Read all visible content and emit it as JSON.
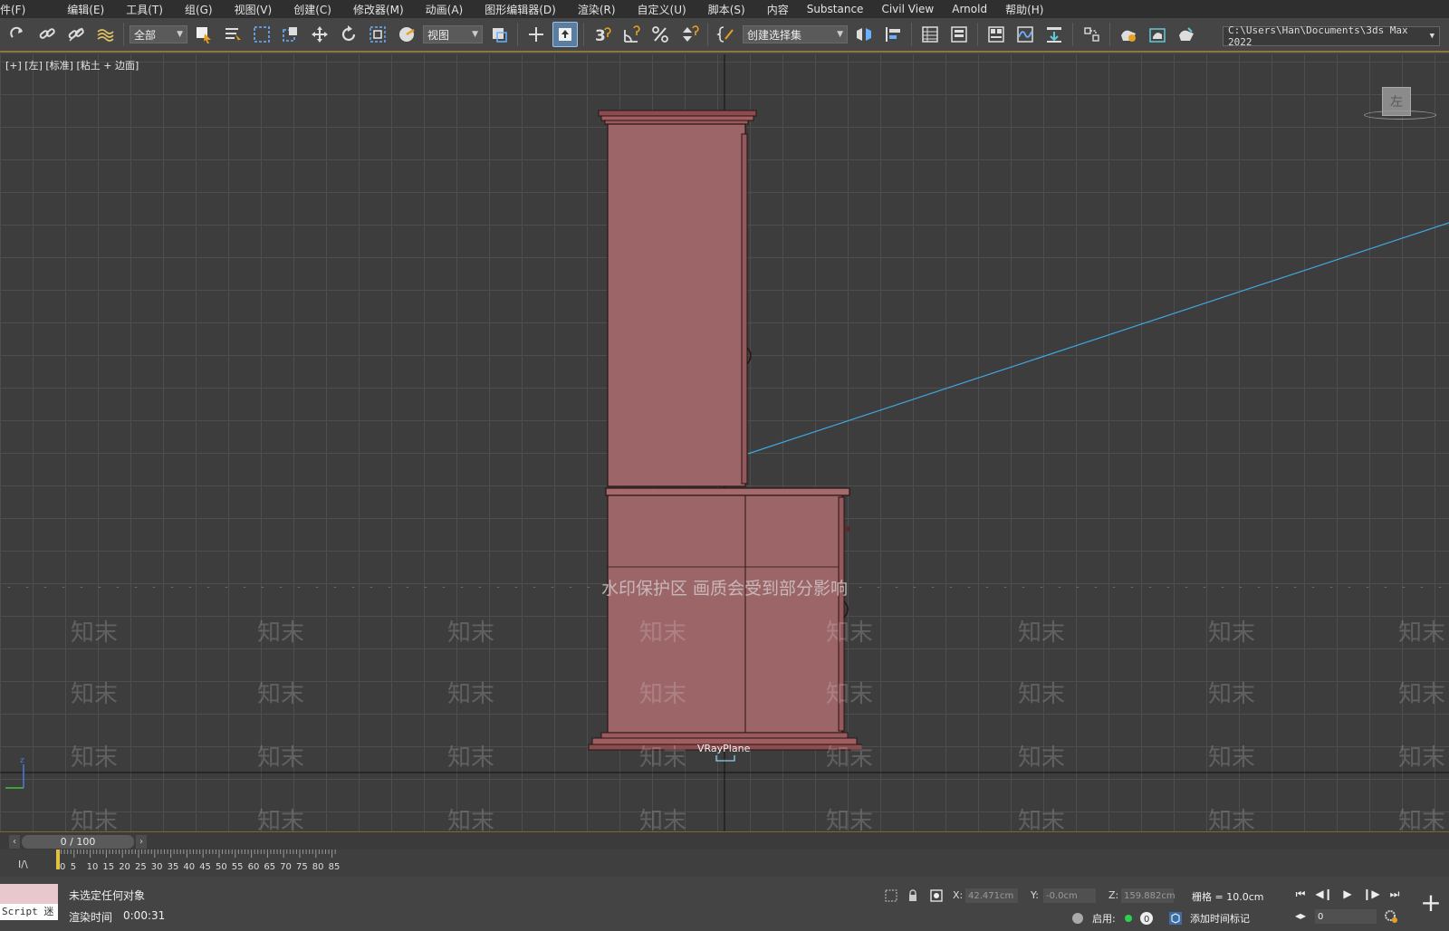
{
  "menu": [
    "件(F)",
    "编辑(E)",
    "工具(T)",
    "组(G)",
    "视图(V)",
    "创建(C)",
    "修改器(M)",
    "动画(A)",
    "图形编辑器(D)",
    "渲染(R)",
    "自定义(U)",
    "脚本(S)",
    "内容",
    "Substance",
    "Civil View",
    "Arnold",
    "帮助(H)"
  ],
  "toolbar": {
    "filter_dropdown": "全部",
    "ref_coord_dropdown": "视图",
    "selection_set_dropdown": "创建选择集",
    "path_field": "C:\\Users\\Han\\Documents\\3ds Max 2022",
    "icons": [
      "redo-icon",
      "link-icon",
      "unlink-icon",
      "bind-spacewarp-icon",
      "select-object-icon",
      "select-by-name-icon",
      "rect-selection-icon",
      "window-crossing-icon",
      "move-icon",
      "rotate-icon",
      "scale-icon",
      "placement-icon",
      "select-manipulate-icon",
      "pivot-icon",
      "snap-3-icon",
      "angle-snap-icon",
      "percent-snap-icon",
      "spinner-snap-icon",
      "edit-named-selection-icon",
      "mirror-icon",
      "align-icon",
      "scene-explorer-icon",
      "layer-explorer-icon",
      "ribbon-icon",
      "curve-editor-icon",
      "schematic-view-icon",
      "material-editor-icon",
      "render-setup-icon",
      "rendered-frame-icon",
      "render-icon"
    ]
  },
  "viewport": {
    "label": "[+] [左] [标准] [粘土 + 边面]",
    "viewcube_label": "左",
    "watermark_banner": "水印保护区  画质会受到部分影响",
    "watermark_text": "知末",
    "object_label": "VRayPlane",
    "cabinet_color": "#9c6568",
    "grid_color": "#4e4e4e",
    "background_color": "#3d3d3d",
    "light_line_color": "#3fa8e0"
  },
  "timeline": {
    "frame_display": "0 / 100",
    "ticks": [
      0,
      5,
      10,
      15,
      20,
      25,
      30,
      35,
      40,
      45,
      50,
      55,
      60,
      65,
      70,
      75,
      80,
      85
    ],
    "key_icon_label": "I/\\"
  },
  "statusbar": {
    "script_label": "Script 迷",
    "selection_status": "未选定任何对象",
    "render_time_label": "渲染时间",
    "render_time_value": "0:00:31",
    "x_label": "X:",
    "x_value": "42.471cm",
    "y_label": "Y:",
    "y_value": "-0.0cm",
    "z_label": "Z:",
    "z_value": "159.882cm",
    "grid_label": "栅格 = 10.0cm",
    "enable_label": "启用:",
    "add_time_tag": "添加时间标记",
    "frame_field": "0"
  }
}
